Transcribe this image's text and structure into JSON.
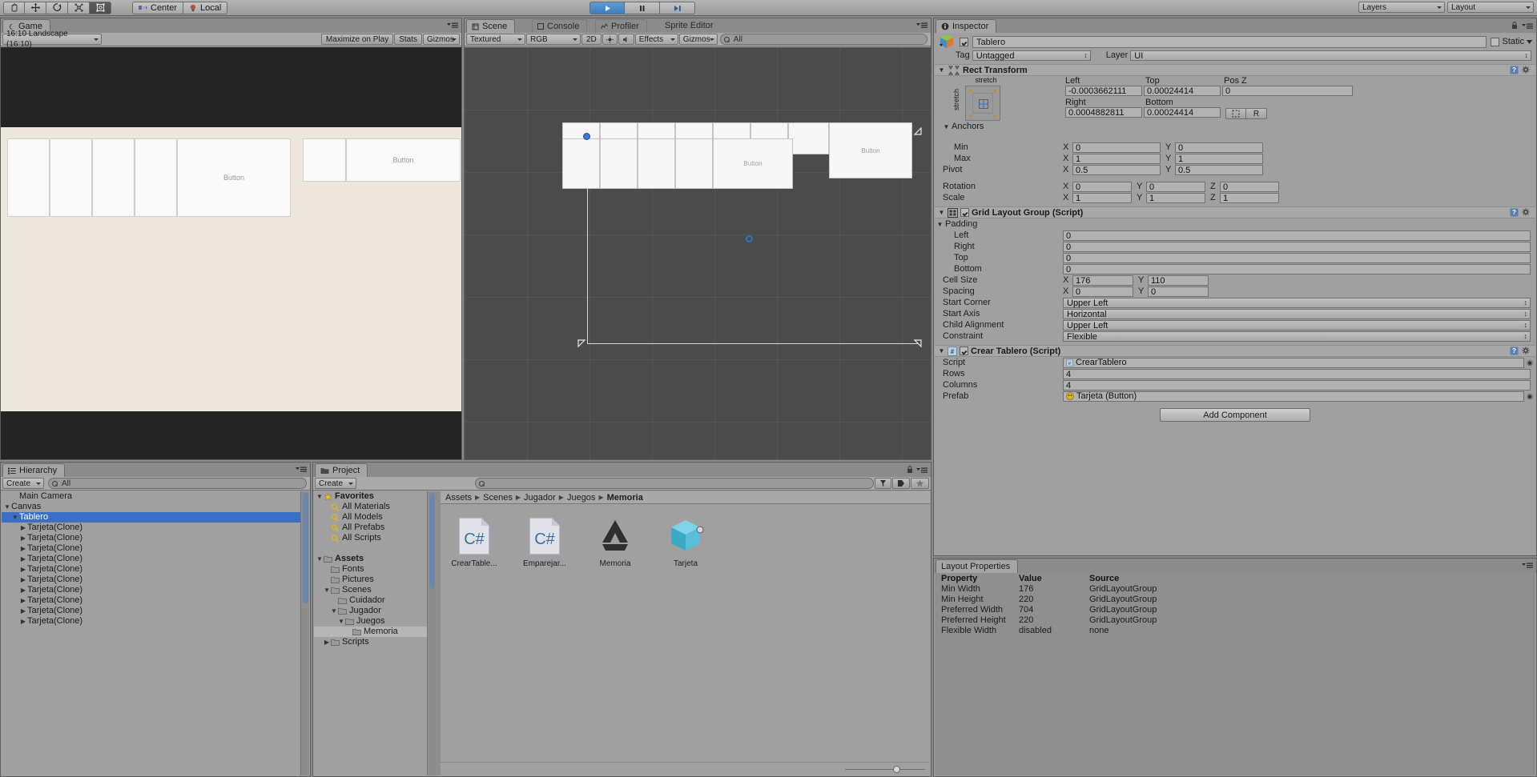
{
  "toolbar": {
    "tools": [
      {
        "name": "hand-tool",
        "selected": false
      },
      {
        "name": "move-tool",
        "selected": false
      },
      {
        "name": "rotate-tool",
        "selected": false
      },
      {
        "name": "scale-tool",
        "selected": false
      },
      {
        "name": "rect-tool",
        "selected": true
      }
    ],
    "pivot_label": "Center",
    "space_label": "Local",
    "play_label": "play-icon",
    "pause_label": "pause-icon",
    "step_label": "step-icon",
    "layers_label": "Layers",
    "layout_label": "Layout"
  },
  "game_view": {
    "tab_label": "Game",
    "aspect": "16:10 Landscape (16:10)",
    "maximize_label": "Maximize on Play",
    "stats_label": "Stats",
    "gizmos_label": "Gizmos",
    "card_label": "Button"
  },
  "scene_view": {
    "tab_label": "Scene",
    "console_tab": "Console",
    "profiler_tab": "Profiler",
    "sprite_editor_tab": "Sprite Editor",
    "shading_mode": "Textured",
    "render_mode": "RGB",
    "mode_2d": "2D",
    "effects_label": "Effects",
    "gizmos_label": "Gizmos",
    "search_placeholder": "All",
    "card_label": "Button"
  },
  "hierarchy": {
    "tab_label": "Hierarchy",
    "create_label": "Create",
    "search_placeholder": "All",
    "items": [
      {
        "label": "Main Camera",
        "depth": 1,
        "expandable": false,
        "selected": false
      },
      {
        "label": "Canvas",
        "depth": 0,
        "expandable": true,
        "selected": false
      },
      {
        "label": "Tablero",
        "depth": 1,
        "expandable": true,
        "selected": true
      },
      {
        "label": "Tarjeta(Clone)",
        "depth": 2,
        "expandable": true,
        "selected": false
      },
      {
        "label": "Tarjeta(Clone)",
        "depth": 2,
        "expandable": true,
        "selected": false
      },
      {
        "label": "Tarjeta(Clone)",
        "depth": 2,
        "expandable": true,
        "selected": false
      },
      {
        "label": "Tarjeta(Clone)",
        "depth": 2,
        "expandable": true,
        "selected": false
      },
      {
        "label": "Tarjeta(Clone)",
        "depth": 2,
        "expandable": true,
        "selected": false
      },
      {
        "label": "Tarjeta(Clone)",
        "depth": 2,
        "expandable": true,
        "selected": false
      },
      {
        "label": "Tarjeta(Clone)",
        "depth": 2,
        "expandable": true,
        "selected": false
      },
      {
        "label": "Tarjeta(Clone)",
        "depth": 2,
        "expandable": true,
        "selected": false
      },
      {
        "label": "Tarjeta(Clone)",
        "depth": 2,
        "expandable": true,
        "selected": false
      },
      {
        "label": "Tarjeta(Clone)",
        "depth": 2,
        "expandable": true,
        "selected": false
      }
    ]
  },
  "project": {
    "tab_label": "Project",
    "create_label": "Create",
    "search_placeholder": "",
    "tree": [
      {
        "label": "Favorites",
        "depth": 0,
        "icon": "star-icon",
        "expandable": true,
        "expanded": true,
        "bold": true,
        "selected": false
      },
      {
        "label": "All Materials",
        "depth": 1,
        "icon": "search-icon",
        "expandable": false,
        "selected": false
      },
      {
        "label": "All Models",
        "depth": 1,
        "icon": "search-icon",
        "expandable": false,
        "selected": false
      },
      {
        "label": "All Prefabs",
        "depth": 1,
        "icon": "search-icon",
        "expandable": false,
        "selected": false
      },
      {
        "label": "All Scripts",
        "depth": 1,
        "icon": "search-icon",
        "expandable": false,
        "selected": false
      },
      {
        "label": "",
        "depth": 0,
        "icon": "none",
        "expandable": false,
        "selected": false
      },
      {
        "label": "Assets",
        "depth": 0,
        "icon": "folder-icon",
        "expandable": true,
        "expanded": true,
        "bold": true,
        "selected": false
      },
      {
        "label": "Fonts",
        "depth": 1,
        "icon": "folder-icon",
        "expandable": false,
        "selected": false
      },
      {
        "label": "Pictures",
        "depth": 1,
        "icon": "folder-icon",
        "expandable": false,
        "selected": false
      },
      {
        "label": "Scenes",
        "depth": 1,
        "icon": "folder-icon",
        "expandable": true,
        "expanded": true,
        "selected": false
      },
      {
        "label": "Cuidador",
        "depth": 2,
        "icon": "folder-icon",
        "expandable": false,
        "selected": false
      },
      {
        "label": "Jugador",
        "depth": 2,
        "icon": "folder-icon",
        "expandable": true,
        "expanded": true,
        "selected": false
      },
      {
        "label": "Juegos",
        "depth": 3,
        "icon": "folder-icon",
        "expandable": true,
        "expanded": true,
        "selected": false
      },
      {
        "label": "Memoria",
        "depth": 4,
        "icon": "folder-icon",
        "expandable": false,
        "selected": true
      },
      {
        "label": "Scripts",
        "depth": 1,
        "icon": "folder-icon",
        "expandable": true,
        "selected": false
      }
    ],
    "breadcrumb": [
      "Assets",
      "Scenes",
      "Jugador",
      "Juegos",
      "Memoria"
    ],
    "assets": [
      {
        "name": "CrearTable...",
        "icon": "csharp-script-icon"
      },
      {
        "name": "Emparejar...",
        "icon": "csharp-script-icon"
      },
      {
        "name": "Memoria",
        "icon": "unity-scene-icon"
      },
      {
        "name": "Tarjeta",
        "icon": "prefab-icon"
      }
    ]
  },
  "inspector": {
    "tab_label": "Inspector",
    "object_name": "Tablero",
    "object_enabled": true,
    "static_label": "Static",
    "static_checked": false,
    "tag_label": "Tag",
    "tag_value": "Untagged",
    "layer_label": "Layer",
    "layer_value": "UI",
    "rect_transform": {
      "title": "Rect Transform",
      "anchor_preset_h": "stretch",
      "anchor_preset_v": "stretch",
      "left_label": "Left",
      "left_value": "-0.0003662111",
      "top_label": "Top",
      "top_value": "0.00024414",
      "posz_label": "Pos Z",
      "posz_value": "0",
      "right_label": "Right",
      "right_value": "0.0004882811",
      "bottom_label": "Bottom",
      "bottom_value": "0.00024414",
      "blueprint_label": "",
      "raw_label": "R",
      "anchors_label": "Anchors",
      "min_label": "Min",
      "min_x": "0",
      "min_y": "0",
      "max_label": "Max",
      "max_x": "1",
      "max_y": "1",
      "pivot_label": "Pivot",
      "pivot_x": "0.5",
      "pivot_y": "0.5",
      "rotation_label": "Rotation",
      "rotation_x": "0",
      "rotation_y": "0",
      "rotation_z": "0",
      "scale_label": "Scale",
      "scale_x": "1",
      "scale_y": "1",
      "scale_z": "1"
    },
    "grid_layout": {
      "title": "Grid Layout Group (Script)",
      "enabled": true,
      "padding_label": "Padding",
      "padding_left_label": "Left",
      "padding_left": "0",
      "padding_right_label": "Right",
      "padding_right": "0",
      "padding_top_label": "Top",
      "padding_top": "0",
      "padding_bottom_label": "Bottom",
      "padding_bottom": "0",
      "cell_size_label": "Cell Size",
      "cell_size_x": "176",
      "cell_size_y": "110",
      "spacing_label": "Spacing",
      "spacing_x": "0",
      "spacing_y": "0",
      "start_corner_label": "Start Corner",
      "start_corner": "Upper Left",
      "start_axis_label": "Start Axis",
      "start_axis": "Horizontal",
      "child_alignment_label": "Child Alignment",
      "child_alignment": "Upper Left",
      "constraint_label": "Constraint",
      "constraint": "Flexible"
    },
    "crear_tablero": {
      "title": "Crear Tablero (Script)",
      "enabled": true,
      "script_label": "Script",
      "script_value": "CrearTablero",
      "rows_label": "Rows",
      "rows_value": "4",
      "columns_label": "Columns",
      "columns_value": "4",
      "prefab_label": "Prefab",
      "prefab_value": "Tarjeta (Button)"
    },
    "add_component_label": "Add Component"
  },
  "layout_properties": {
    "tab_label": "Layout Properties",
    "columns": [
      "Property",
      "Value",
      "Source"
    ],
    "rows": [
      {
        "property": "Min Width",
        "value": "176",
        "source": "GridLayoutGroup"
      },
      {
        "property": "Min Height",
        "value": "220",
        "source": "GridLayoutGroup"
      },
      {
        "property": "Preferred Width",
        "value": "704",
        "source": "GridLayoutGroup"
      },
      {
        "property": "Preferred Height",
        "value": "220",
        "source": "GridLayoutGroup"
      },
      {
        "property": "Flexible Width",
        "value": "disabled",
        "source": "none"
      }
    ]
  },
  "colors": {
    "accent_blue": "#3a6fc4",
    "panel_bg": "#a0a0a0",
    "scene_bg": "#4b4b4b",
    "game_bg": "#242424",
    "stage_bg": "#ece8dd"
  }
}
